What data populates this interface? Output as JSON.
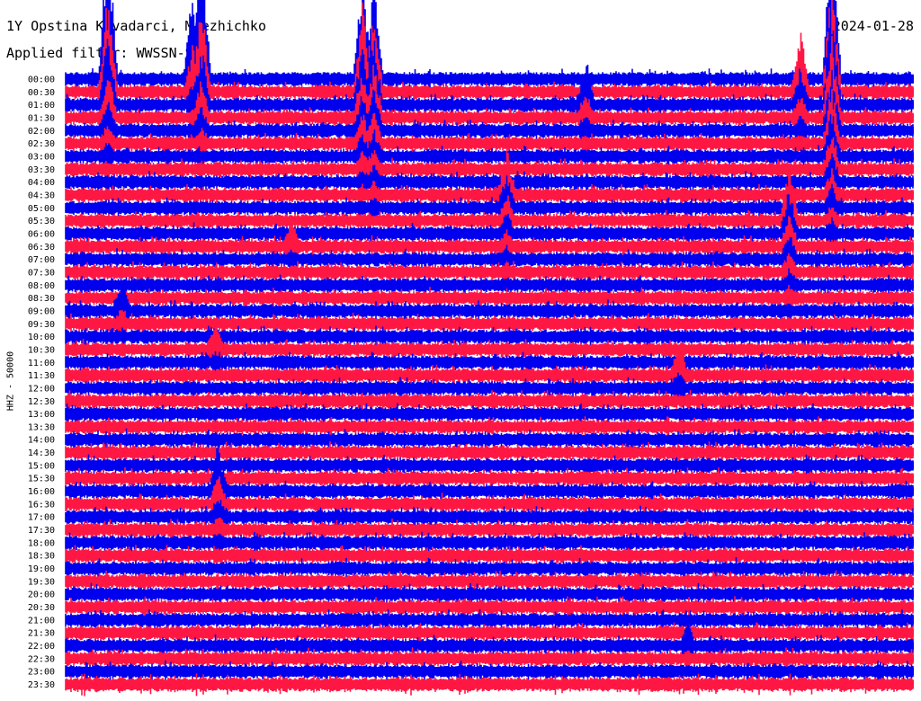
{
  "header": {
    "title": "1Y Opstina Kavadarci, Mrezhichko",
    "date": "2024-01-28",
    "filter": "Applied filter: WWSSN-SP"
  },
  "chart_data": {
    "type": "line",
    "ylabel": "HHZ - 50000",
    "row_labels": [
      "00:00",
      "00:30",
      "01:00",
      "01:30",
      "02:00",
      "02:30",
      "03:00",
      "03:30",
      "04:00",
      "04:30",
      "05:00",
      "05:30",
      "06:00",
      "06:30",
      "07:00",
      "07:30",
      "08:00",
      "08:30",
      "09:00",
      "09:30",
      "10:00",
      "10:30",
      "11:00",
      "11:30",
      "12:00",
      "12:30",
      "13:00",
      "13:30",
      "14:00",
      "14:30",
      "15:00",
      "15:30",
      "16:00",
      "16:30",
      "17:00",
      "17:30",
      "18:00",
      "18:30",
      "19:00",
      "19:30",
      "20:00",
      "20:30",
      "21:00",
      "21:30",
      "22:00",
      "22:30",
      "23:00",
      "23:30"
    ],
    "minutes_per_row": 30,
    "series_colors": [
      "#0000ee",
      "#ff1744"
    ],
    "events": [
      {
        "row": 0,
        "minute": 1.5,
        "amplitude": 12,
        "duration": 6
      },
      {
        "row": 0,
        "minute": 4.5,
        "amplitude": 8,
        "duration": 3
      },
      {
        "row": 0,
        "minute": 4.8,
        "amplitude": 12,
        "duration": 5
      },
      {
        "row": 0,
        "minute": 10.5,
        "amplitude": 9,
        "duration": 9
      },
      {
        "row": 0,
        "minute": 10.9,
        "amplitude": 9,
        "duration": 10
      },
      {
        "row": 2,
        "minute": 10.8,
        "amplitude": 5,
        "duration": 2
      },
      {
        "row": 2,
        "minute": 18.4,
        "amplitude": 4,
        "duration": 4
      },
      {
        "row": 1,
        "minute": 26.0,
        "amplitude": 5,
        "duration": 5
      },
      {
        "row": 0,
        "minute": 27.1,
        "amplitude": 12,
        "duration": 12
      },
      {
        "row": 9,
        "minute": 15.6,
        "amplitude": 4,
        "duration": 9
      },
      {
        "row": 11,
        "minute": 25.6,
        "amplitude": 5,
        "duration": 9
      },
      {
        "row": 13,
        "minute": 8.0,
        "amplitude": 2.5,
        "duration": 2
      },
      {
        "row": 18,
        "minute": 2.0,
        "amplitude": 3,
        "duration": 3
      },
      {
        "row": 21,
        "minute": 5.3,
        "amplitude": 2.5,
        "duration": 2
      },
      {
        "row": 23,
        "minute": 21.7,
        "amplitude": 3,
        "duration": 3
      },
      {
        "row": 32,
        "minute": 5.4,
        "amplitude": 4,
        "duration": 6
      },
      {
        "row": 44,
        "minute": 22.0,
        "amplitude": 2,
        "duration": 2
      }
    ]
  }
}
